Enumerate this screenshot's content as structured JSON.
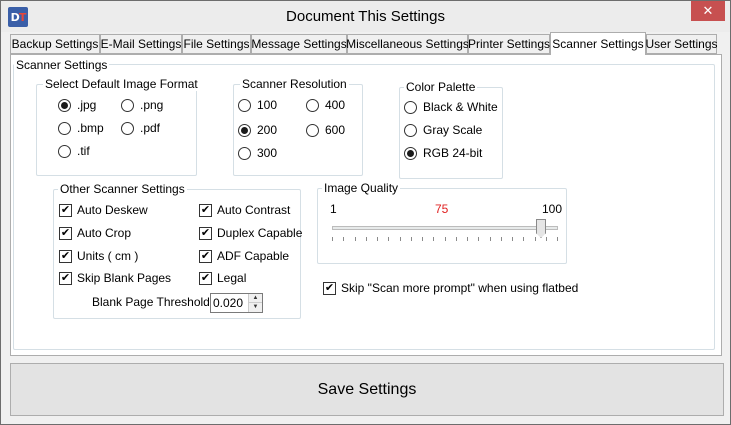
{
  "window": {
    "title": "Document This Settings",
    "icon_letters": [
      "D",
      "T"
    ],
    "close_glyph": "✕"
  },
  "tabs": [
    {
      "label": "Backup Settings"
    },
    {
      "label": "E-Mail Settings"
    },
    {
      "label": "File Settings"
    },
    {
      "label": "Message Settings"
    },
    {
      "label": "Miscellaneous Settings"
    },
    {
      "label": "Printer Settings"
    },
    {
      "label": "Scanner Settings",
      "active": true
    },
    {
      "label": "User Settings"
    }
  ],
  "scanner": {
    "group_title": "Scanner Settings",
    "image_format": {
      "title": "Select Default Image Format",
      "options": [
        {
          "label": ".jpg",
          "selected": true
        },
        {
          "label": ".png",
          "selected": false
        },
        {
          "label": ".bmp",
          "selected": false
        },
        {
          "label": ".pdf",
          "selected": false
        },
        {
          "label": ".tif",
          "selected": false
        }
      ]
    },
    "resolution": {
      "title": "Scanner Resolution",
      "options": [
        {
          "label": "100",
          "selected": false
        },
        {
          "label": "400",
          "selected": false
        },
        {
          "label": "200",
          "selected": true
        },
        {
          "label": "600",
          "selected": false
        },
        {
          "label": "300",
          "selected": false
        }
      ]
    },
    "color_palette": {
      "title": "Color Palette",
      "options": [
        {
          "label": "Black & White",
          "selected": false
        },
        {
          "label": "Gray Scale",
          "selected": false
        },
        {
          "label": "RGB 24-bit",
          "selected": true
        }
      ]
    },
    "other": {
      "title": "Other Scanner Settings",
      "checks": [
        {
          "label": "Auto Deskew",
          "checked": true
        },
        {
          "label": "Auto Contrast",
          "checked": true
        },
        {
          "label": "Auto Crop",
          "checked": true
        },
        {
          "label": "Duplex Capable",
          "checked": true
        },
        {
          "label": "Units ( cm )",
          "checked": true
        },
        {
          "label": "ADF Capable",
          "checked": true
        },
        {
          "label": "Skip Blank Pages",
          "checked": true
        },
        {
          "label": "Legal",
          "checked": true
        }
      ],
      "threshold_label": "Blank Page Threshold:",
      "threshold_value": "0.020"
    },
    "image_quality": {
      "title": "Image Quality",
      "min_label": "1",
      "current_label": "75",
      "max_label": "100",
      "value": 75,
      "min": 1,
      "max": 100,
      "current_color": "#e02020"
    },
    "skip_scan_more": {
      "label": "Skip \"Scan more prompt\" when using flatbed",
      "checked": true
    }
  },
  "footer": {
    "save_label": "Save Settings"
  },
  "check_glyph": "✔"
}
